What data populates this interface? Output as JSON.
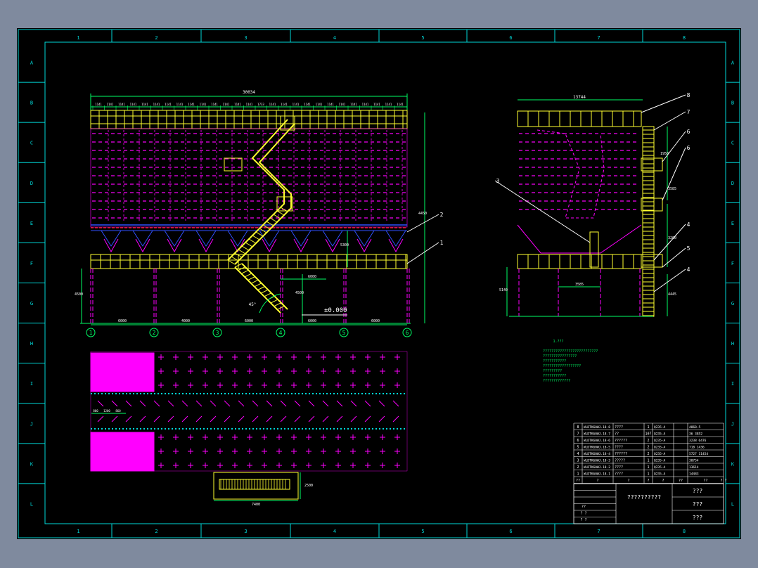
{
  "colors": {
    "background": "#7f8a9e",
    "sheet": "#000000",
    "frame": "#00d8d8",
    "structure": "#ffff30",
    "detail": "#ff00ff",
    "dimension": "#00ff66",
    "flow": "#3050ff",
    "red": "#ff2020",
    "white": "#ffffff"
  },
  "grid": {
    "columns_top": [
      "1",
      "2",
      "3",
      "4",
      "5",
      "6",
      "7",
      "8"
    ],
    "columns_bottom": [
      "1",
      "2",
      "3",
      "4",
      "5",
      "6",
      "7",
      "8"
    ],
    "rows_left": [
      "A",
      "B",
      "C",
      "D",
      "E",
      "F",
      "G",
      "H",
      "I",
      "J",
      "K",
      "L"
    ],
    "rows_right": [
      "A",
      "B",
      "C",
      "D",
      "E",
      "F",
      "G",
      "H",
      "I",
      "J",
      "K",
      "L"
    ]
  },
  "front_elevation": {
    "overall_width": "30034",
    "top_spacings": [
      "1141",
      "1141",
      "1141",
      "1141",
      "1141",
      "1141",
      "1141",
      "1141",
      "1141",
      "1141",
      "1141",
      "1141",
      "1141",
      "1141",
      "1733",
      "1141",
      "1141",
      "1141",
      "1141",
      "1141",
      "1141",
      "1141",
      "1141",
      "1141",
      "1141",
      "1141",
      "1141"
    ],
    "bay_dims": [
      "6000",
      "4000",
      "6000",
      "6000",
      "6000"
    ],
    "axis_labels": [
      "1",
      "2",
      "3",
      "4",
      "5",
      "6"
    ],
    "level_dims": [
      "4500",
      "4500",
      "6000",
      "5300",
      "4450"
    ],
    "datum": "±0.000",
    "callouts": [
      "2",
      "1"
    ],
    "angle": "45°"
  },
  "side_elevation": {
    "overall_width": "13744",
    "width_dim": "3585",
    "height_dims": [
      "5140",
      "3200",
      "4445",
      "3585",
      "1950"
    ],
    "callouts": [
      "8",
      "7",
      "6",
      "6",
      "3",
      "4",
      "5",
      "4"
    ]
  },
  "plan_detail": {
    "width_dim": "7400",
    "height_dim": "2500",
    "small_dims": [
      "800",
      "1200",
      "860"
    ]
  },
  "notes": {
    "title": "1.???",
    "lines": [
      "??????????????????????????",
      "????????????????",
      "???????????",
      "??????????????????",
      "?????????",
      "???????????",
      "?????????????"
    ]
  },
  "bom": [
    {
      "no": "8",
      "code": "WLDTK60WJ.18-8",
      "name": "????",
      "qty": "1",
      "material": "Q235-A",
      "weight": "4868.5"
    },
    {
      "no": "7",
      "code": "WLDTK60WJ.18-7",
      "name": "??",
      "qty": "107",
      "material": "Q235-A",
      "weight": "36  3852"
    },
    {
      "no": "6",
      "code": "WLDTK60WJ.18-6",
      "name": "??????",
      "qty": "2",
      "material": "Q235-A",
      "weight": "3238 6476"
    },
    {
      "no": "5",
      "code": "WLDTK60WJ.18-5",
      "name": "????",
      "qty": "2",
      "material": "Q235-A",
      "weight": "718 1436"
    },
    {
      "no": "4",
      "code": "WLDTK60WJ.18-4",
      "name": "??????",
      "qty": "2",
      "material": "Q235-A",
      "weight": "5727 11454"
    },
    {
      "no": "3",
      "code": "WLDTK60WJ.18-3",
      "name": "?????",
      "qty": "1",
      "material": "Q235-A",
      "weight": "30754"
    },
    {
      "no": "2",
      "code": "WLDTK60WJ.18-2",
      "name": "????",
      "qty": "1",
      "material": "Q235-A",
      "weight": "13614"
    },
    {
      "no": "1",
      "code": "WLDTK60WJ.18-1",
      "name": "????",
      "qty": "1",
      "material": "Q235-A",
      "weight": "14483"
    }
  ],
  "bom_header": [
    "??",
    "?",
    "?",
    "?",
    "?",
    "??",
    "??",
    "?  ?"
  ],
  "title_block": {
    "title": "??????????",
    "right_top": "???",
    "right_mid": "???",
    "right_bottom": "???",
    "left_rows": [
      "??",
      "?  ?",
      "?  ?"
    ]
  }
}
